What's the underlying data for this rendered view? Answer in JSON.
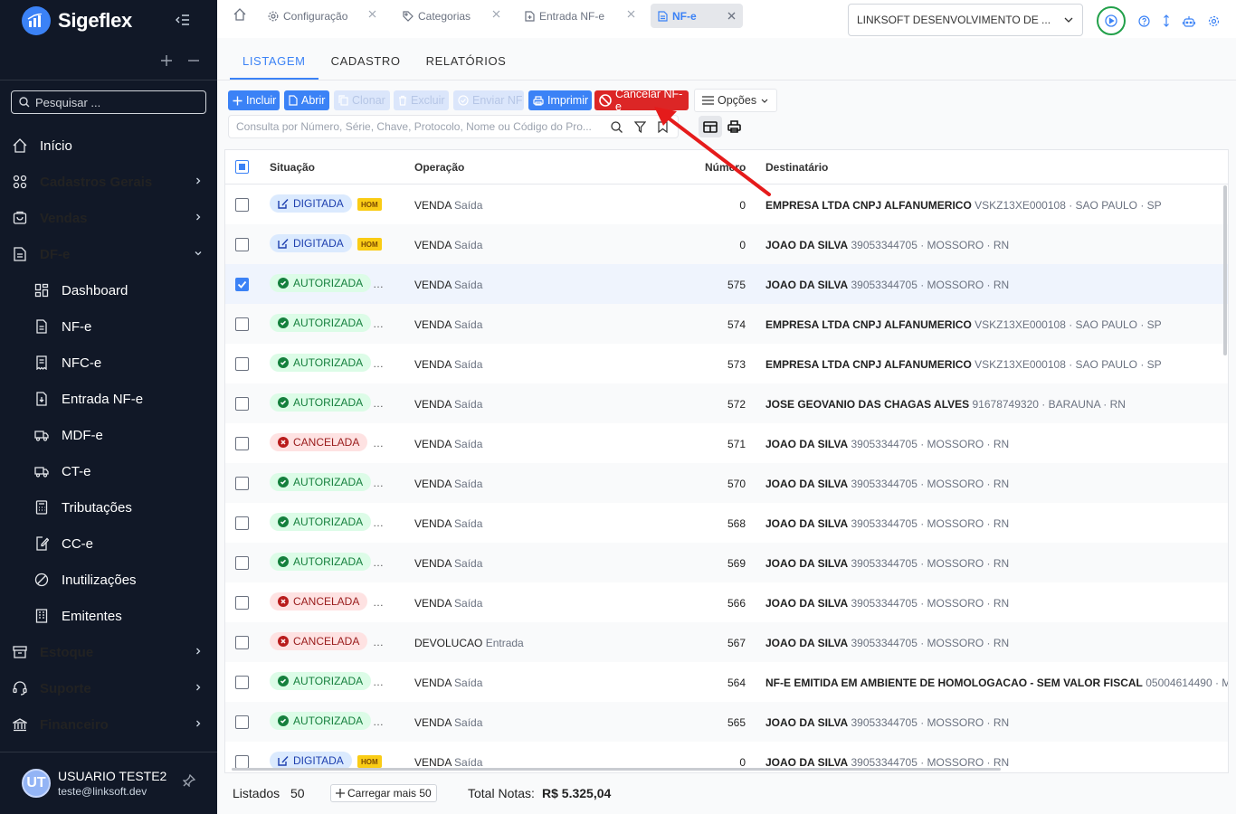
{
  "app": {
    "name": "Sigeflex"
  },
  "sidebar": {
    "search_placeholder": "Pesquisar ...",
    "items": [
      {
        "label": "Início",
        "icon": "home-icon",
        "bold": false,
        "sub": false,
        "chevron": ""
      },
      {
        "label": "Cadastros Gerais",
        "icon": "grid-icon",
        "bold": true,
        "sub": false,
        "chevron": "right"
      },
      {
        "label": "Vendas",
        "icon": "cart-icon",
        "bold": true,
        "sub": false,
        "chevron": "right"
      },
      {
        "label": "DF-e",
        "icon": "document-icon",
        "bold": true,
        "sub": false,
        "chevron": "down"
      },
      {
        "label": "Dashboard",
        "icon": "dashboard-icon",
        "bold": false,
        "sub": true,
        "chevron": ""
      },
      {
        "label": "NF-e",
        "icon": "file-icon",
        "bold": false,
        "sub": true,
        "chevron": ""
      },
      {
        "label": "NFC-e",
        "icon": "receipt-icon",
        "bold": false,
        "sub": true,
        "chevron": ""
      },
      {
        "label": "Entrada NF-e",
        "icon": "file-import-icon",
        "bold": false,
        "sub": true,
        "chevron": ""
      },
      {
        "label": "MDF-e",
        "icon": "truck-icon",
        "bold": false,
        "sub": true,
        "chevron": ""
      },
      {
        "label": "CT-e",
        "icon": "truck-icon",
        "bold": false,
        "sub": true,
        "chevron": ""
      },
      {
        "label": "Tributações",
        "icon": "calculator-icon",
        "bold": false,
        "sub": true,
        "chevron": ""
      },
      {
        "label": "CC-e",
        "icon": "edit-file-icon",
        "bold": false,
        "sub": true,
        "chevron": ""
      },
      {
        "label": "Inutilizações",
        "icon": "ban-icon",
        "bold": false,
        "sub": true,
        "chevron": ""
      },
      {
        "label": "Emitentes",
        "icon": "building-icon",
        "bold": false,
        "sub": true,
        "chevron": ""
      },
      {
        "label": "Estoque",
        "icon": "archive-icon",
        "bold": true,
        "sub": false,
        "chevron": "right"
      },
      {
        "label": "Suporte",
        "icon": "headset-icon",
        "bold": true,
        "sub": false,
        "chevron": "right"
      },
      {
        "label": "Financeiro",
        "icon": "bank-icon",
        "bold": true,
        "sub": false,
        "chevron": "right"
      }
    ],
    "user": {
      "initials": "UT",
      "name": "USUARIO TESTE2",
      "email": "teste@linksoft.dev"
    }
  },
  "topbar": {
    "tabs": [
      {
        "label": "Configuração",
        "icon": "gear-icon",
        "active": false
      },
      {
        "label": "Categorias",
        "icon": "tag-icon",
        "active": false
      },
      {
        "label": "Entrada NF-e",
        "icon": "file-import-icon",
        "active": false
      },
      {
        "label": "NF-e",
        "icon": "file-icon",
        "active": true
      }
    ],
    "company": "LINKSOFT DESENVOLVIMENTO DE ..."
  },
  "subtabs": [
    {
      "label": "LISTAGEM",
      "active": true
    },
    {
      "label": "CADASTRO",
      "active": false
    },
    {
      "label": "RELATÓRIOS",
      "active": false
    }
  ],
  "toolbar": {
    "buttons": [
      {
        "label": "Incluir",
        "icon": "plus-icon",
        "style": "blue"
      },
      {
        "label": "Abrir",
        "icon": "file-icon",
        "style": "blue"
      },
      {
        "label": "Clonar",
        "icon": "copy-icon",
        "style": "disabled"
      },
      {
        "label": "Excluir",
        "icon": "trash-icon",
        "style": "disabled"
      },
      {
        "label": "Enviar NF",
        "icon": "check-circle-icon",
        "style": "disabled"
      },
      {
        "label": "Imprimir",
        "icon": "printer-icon",
        "style": "blue"
      },
      {
        "label": "Cancelar NF-e",
        "icon": "ban-icon",
        "style": "red"
      },
      {
        "label": "Opções",
        "icon": "menu-icon",
        "style": "opts"
      }
    ],
    "query_placeholder": "Consulta por Número, Série, Chave, Protocolo, Nome ou Código do Pro..."
  },
  "grid": {
    "columns": {
      "situacao": "Situação",
      "operacao": "Operação",
      "numero": "Número",
      "destinatario": "Destinatário"
    },
    "rows": [
      {
        "status": "DIGITADA",
        "kind": "dig",
        "tag": "HOM",
        "op": "VENDA",
        "tipo": "Saída",
        "num": "0",
        "nome": "EMPRESA LTDA CNPJ ALFANUMERICO",
        "info": "VSKZ13XE000108 · SAO PAULO · SP",
        "checked": false
      },
      {
        "status": "DIGITADA",
        "kind": "dig",
        "tag": "HOM",
        "op": "VENDA",
        "tipo": "Saída",
        "num": "0",
        "nome": "JOAO DA SILVA",
        "info": "39053344705 · MOSSORO · RN",
        "checked": false
      },
      {
        "status": "AUTORIZADA",
        "kind": "aut",
        "tag": "",
        "op": "VENDA",
        "tipo": "Saída",
        "num": "575",
        "nome": "JOAO DA SILVA",
        "info": "39053344705 · MOSSORO · RN",
        "checked": true
      },
      {
        "status": "AUTORIZADA",
        "kind": "aut",
        "tag": "",
        "op": "VENDA",
        "tipo": "Saída",
        "num": "574",
        "nome": "EMPRESA LTDA CNPJ ALFANUMERICO",
        "info": "VSKZ13XE000108 · SAO PAULO · SP",
        "checked": false
      },
      {
        "status": "AUTORIZADA",
        "kind": "aut",
        "tag": "",
        "op": "VENDA",
        "tipo": "Saída",
        "num": "573",
        "nome": "EMPRESA LTDA CNPJ ALFANUMERICO",
        "info": "VSKZ13XE000108 · SAO PAULO · SP",
        "checked": false
      },
      {
        "status": "AUTORIZADA",
        "kind": "aut",
        "tag": "",
        "op": "VENDA",
        "tipo": "Saída",
        "num": "572",
        "nome": "JOSE GEOVANIO DAS CHAGAS ALVES",
        "info": "91678749320 · BARAUNA · RN",
        "checked": false
      },
      {
        "status": "CANCELADA",
        "kind": "can",
        "tag": "",
        "op": "VENDA",
        "tipo": "Saída",
        "num": "571",
        "nome": "JOAO DA SILVA",
        "info": "39053344705 · MOSSORO · RN",
        "checked": false
      },
      {
        "status": "AUTORIZADA",
        "kind": "aut",
        "tag": "",
        "op": "VENDA",
        "tipo": "Saída",
        "num": "570",
        "nome": "JOAO DA SILVA",
        "info": "39053344705 · MOSSORO · RN",
        "checked": false
      },
      {
        "status": "AUTORIZADA",
        "kind": "aut",
        "tag": "",
        "op": "VENDA",
        "tipo": "Saída",
        "num": "568",
        "nome": "JOAO DA SILVA",
        "info": "39053344705 · MOSSORO · RN",
        "checked": false
      },
      {
        "status": "AUTORIZADA",
        "kind": "aut",
        "tag": "",
        "op": "VENDA",
        "tipo": "Saída",
        "num": "569",
        "nome": "JOAO DA SILVA",
        "info": "39053344705 · MOSSORO · RN",
        "checked": false
      },
      {
        "status": "CANCELADA",
        "kind": "can",
        "tag": "",
        "op": "VENDA",
        "tipo": "Saída",
        "num": "566",
        "nome": "JOAO DA SILVA",
        "info": "39053344705 · MOSSORO · RN",
        "checked": false
      },
      {
        "status": "CANCELADA",
        "kind": "can",
        "tag": "",
        "op": "DEVOLUCAO",
        "tipo": "Entrada",
        "num": "567",
        "nome": "JOAO DA SILVA",
        "info": "39053344705 · MOSSORO · RN",
        "checked": false
      },
      {
        "status": "AUTORIZADA",
        "kind": "aut",
        "tag": "",
        "op": "VENDA",
        "tipo": "Saída",
        "num": "564",
        "nome": "NF-E EMITIDA EM AMBIENTE DE HOMOLOGACAO - SEM VALOR FISCAL",
        "info": "05004614490 · M",
        "checked": false
      },
      {
        "status": "AUTORIZADA",
        "kind": "aut",
        "tag": "",
        "op": "VENDA",
        "tipo": "Saída",
        "num": "565",
        "nome": "JOAO DA SILVA",
        "info": "39053344705 · MOSSORO · RN",
        "checked": false
      },
      {
        "status": "DIGITADA",
        "kind": "dig",
        "tag": "HOM",
        "op": "VENDA",
        "tipo": "Saída",
        "num": "0",
        "nome": "JOAO DA SILVA",
        "info": "39053344705 · MOSSORO · RN",
        "checked": false
      }
    ]
  },
  "footer": {
    "listados_label": "Listados",
    "listados": "50",
    "load_more": "Carregar mais 50",
    "total_label": "Total Notas:",
    "total": "R$ 5.325,04"
  },
  "colors": {
    "primary": "#3b82f6",
    "danger": "#dc2626",
    "sidebar": "#111827",
    "success": "#15803d",
    "annotation_arrow": "#e51b1b"
  }
}
